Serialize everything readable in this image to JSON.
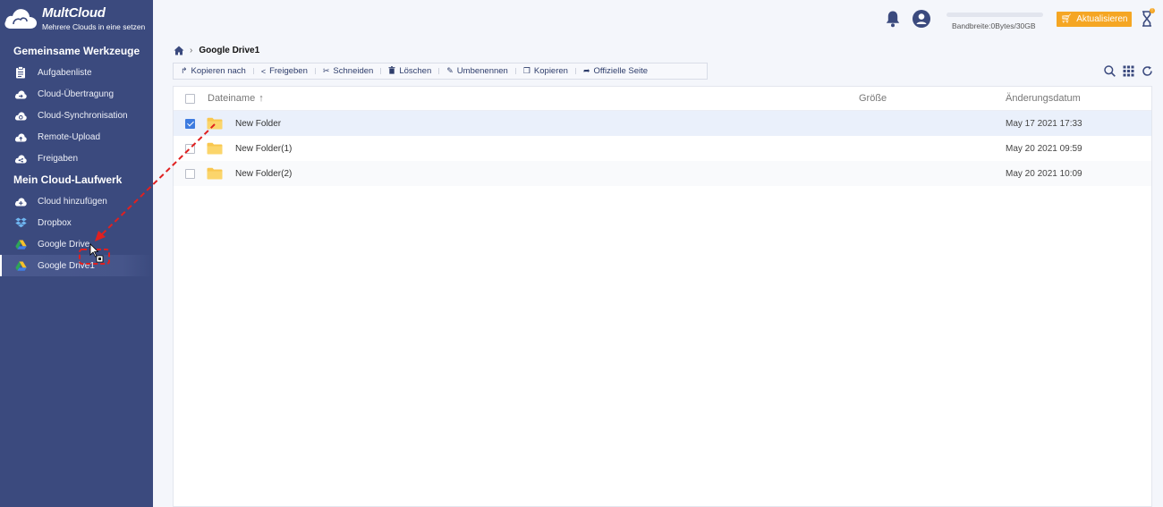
{
  "brand": {
    "name": "MultCloud",
    "tagline": "Mehrere Clouds in eine setzen"
  },
  "sidebar": {
    "section_tools": "Gemeinsame Werkzeuge",
    "tools": [
      {
        "label": "Aufgabenliste",
        "icon": "clipboard-icon"
      },
      {
        "label": "Cloud-Übertragung",
        "icon": "cloud-transfer-icon"
      },
      {
        "label": "Cloud-Synchronisation",
        "icon": "cloud-sync-icon"
      },
      {
        "label": "Remote-Upload",
        "icon": "cloud-upload-icon"
      },
      {
        "label": "Freigaben",
        "icon": "cloud-share-icon"
      }
    ],
    "section_drives": "Mein Cloud-Laufwerk",
    "drives": [
      {
        "label": "Cloud hinzufügen",
        "icon": "cloud-add-icon"
      },
      {
        "label": "Dropbox",
        "icon": "dropbox-icon"
      },
      {
        "label": "Google Drive",
        "icon": "google-drive-icon"
      },
      {
        "label": "Google Drive1",
        "icon": "google-drive-icon",
        "active": true
      }
    ]
  },
  "header": {
    "bandwidth": "Bandbreite:0Bytes/30GB",
    "upgrade_label": "Aktualisieren",
    "notification_badge": "!"
  },
  "breadcrumb": {
    "current": "Google Drive1"
  },
  "toolbar": [
    {
      "label": "Kopieren nach",
      "icon": "↱"
    },
    {
      "label": "Freigeben",
      "icon": "<"
    },
    {
      "label": "Schneiden",
      "icon": "✂"
    },
    {
      "label": "Löschen",
      "icon": "🗑"
    },
    {
      "label": "Umbenennen",
      "icon": "✎"
    },
    {
      "label": "Kopieren",
      "icon": "❐"
    },
    {
      "label": "Offizielle Seite",
      "icon": "➦"
    }
  ],
  "columns": {
    "name": "Dateiname",
    "size": "Größe",
    "date": "Änderungsdatum"
  },
  "files": [
    {
      "name": "New Folder",
      "size": "",
      "date": "May 17 2021 17:33",
      "checked": true
    },
    {
      "name": "New Folder(1)",
      "size": "",
      "date": "May 20 2021 09:59",
      "checked": false
    },
    {
      "name": "New Folder(2)",
      "size": "",
      "date": "May 20 2021 10:09",
      "checked": false
    }
  ],
  "colors": {
    "sidebar": "#3b4a7e",
    "accent": "#f5a623",
    "drag_arrow": "#e02020",
    "folder": "#f9c74f",
    "check": "#3d7be0"
  }
}
